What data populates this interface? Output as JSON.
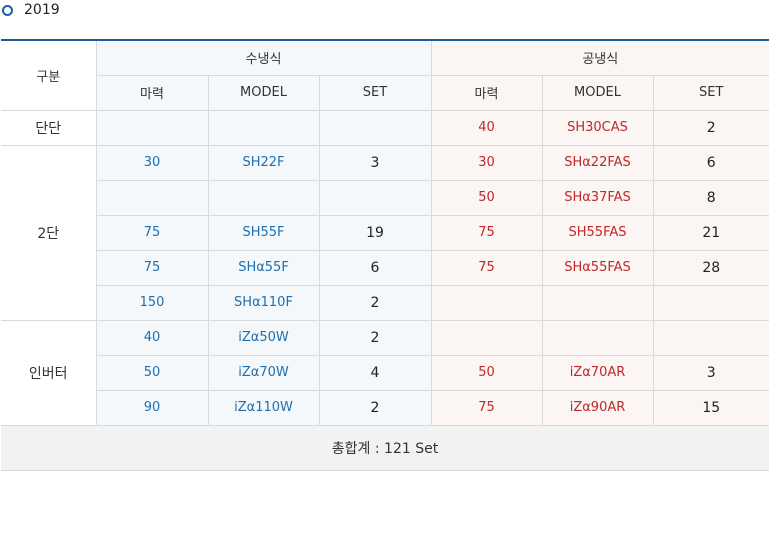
{
  "section": {
    "year": "2019"
  },
  "table": {
    "header": {
      "gubun": "구분",
      "water": "수냉식",
      "air": "공냉식",
      "sub": [
        "마력",
        "MODEL",
        "SET",
        "마력",
        "MODEL",
        "SET"
      ]
    },
    "groups": {
      "dandan": "단단",
      "twostage": "2단",
      "inverter": "인버터"
    },
    "rows": [
      [
        "",
        "",
        "",
        "40",
        "SH30CAS",
        "2"
      ],
      [
        "30",
        "SH22F",
        "3",
        "30",
        "SHα22FAS",
        "6"
      ],
      [
        "",
        "",
        "",
        "50",
        "SHα37FAS",
        "8"
      ],
      [
        "75",
        "SH55F",
        "19",
        "75",
        "SH55FAS",
        "21"
      ],
      [
        "75",
        "SHα55F",
        "6",
        "75",
        "SHα55FAS",
        "28"
      ],
      [
        "150",
        "SHα110F",
        "2",
        "",
        "",
        ""
      ],
      [
        "40",
        "iZα50W",
        "2",
        "",
        "",
        ""
      ],
      [
        "50",
        "iZα70W",
        "4",
        "50",
        "iZα70AR",
        "3"
      ],
      [
        "90",
        "iZα110W",
        "2",
        "75",
        "iZα90AR",
        "15"
      ]
    ],
    "total": "총합계 : 121 Set"
  }
}
